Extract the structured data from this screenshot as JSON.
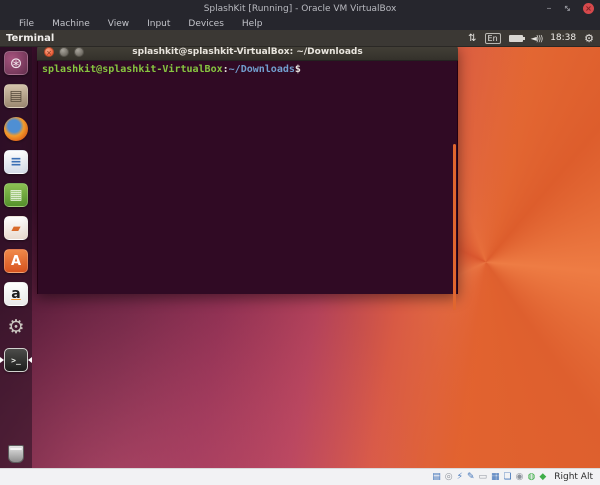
{
  "window": {
    "title": "SplashKit [Running] - Oracle VM VirtualBox",
    "controls": {
      "minimize": "–",
      "restore": "↔",
      "close": "×"
    },
    "menus": [
      {
        "label": "File"
      },
      {
        "label": "Machine"
      },
      {
        "label": "View"
      },
      {
        "label": "Input"
      },
      {
        "label": "Devices"
      },
      {
        "label": "Help"
      }
    ]
  },
  "panel": {
    "app_name": "Terminal",
    "tray": {
      "network_glyph": "⇅",
      "keyboard_layout": "En",
      "volume_glyph": "◄)))",
      "time": "18:38",
      "gear_glyph": "⚙"
    }
  },
  "launcher": {
    "items": [
      {
        "name": "ubuntu-dash",
        "glyph": "⊛"
      },
      {
        "name": "files",
        "glyph": "▤"
      },
      {
        "name": "firefox",
        "glyph": ""
      },
      {
        "name": "libreoffice-writer",
        "glyph": "≡"
      },
      {
        "name": "libreoffice-calc",
        "glyph": "▦"
      },
      {
        "name": "libreoffice-impress",
        "glyph": "▰"
      },
      {
        "name": "ubuntu-software",
        "glyph": "A"
      },
      {
        "name": "amazon",
        "glyph": "a"
      },
      {
        "name": "system-settings",
        "glyph": "⚙"
      },
      {
        "name": "terminal",
        "glyph": ">_"
      }
    ]
  },
  "terminal": {
    "title": "splashkit@splashkit-VirtualBox: ~/Downloads",
    "buttons": {
      "close": "×"
    },
    "prompt": {
      "user_host": "splashkit@splashkit-VirtualBox",
      "colon": ":",
      "path": "~/Downloads",
      "dollar": "$"
    }
  },
  "statusbar": {
    "icons": [
      {
        "name": "hard-disks",
        "glyph": "▤"
      },
      {
        "name": "optical-drives",
        "glyph": "◎"
      },
      {
        "name": "usb-devices",
        "glyph": "⚡"
      },
      {
        "name": "audio",
        "glyph": "✎"
      },
      {
        "name": "network",
        "glyph": "▭"
      },
      {
        "name": "display",
        "glyph": "▦"
      },
      {
        "name": "shared-folders",
        "glyph": "❏"
      },
      {
        "name": "video-capture",
        "glyph": "◉"
      },
      {
        "name": "features",
        "glyph": "◍"
      },
      {
        "name": "mouse-integration",
        "glyph": "◆"
      }
    ],
    "host_key": "Right Alt"
  },
  "colors": {
    "terminal_bg": "#300a24",
    "prompt_green": "#87c540",
    "prompt_blue": "#729fcf",
    "accent_orange": "#e0662f",
    "titlebar_dark": "#26262d"
  }
}
